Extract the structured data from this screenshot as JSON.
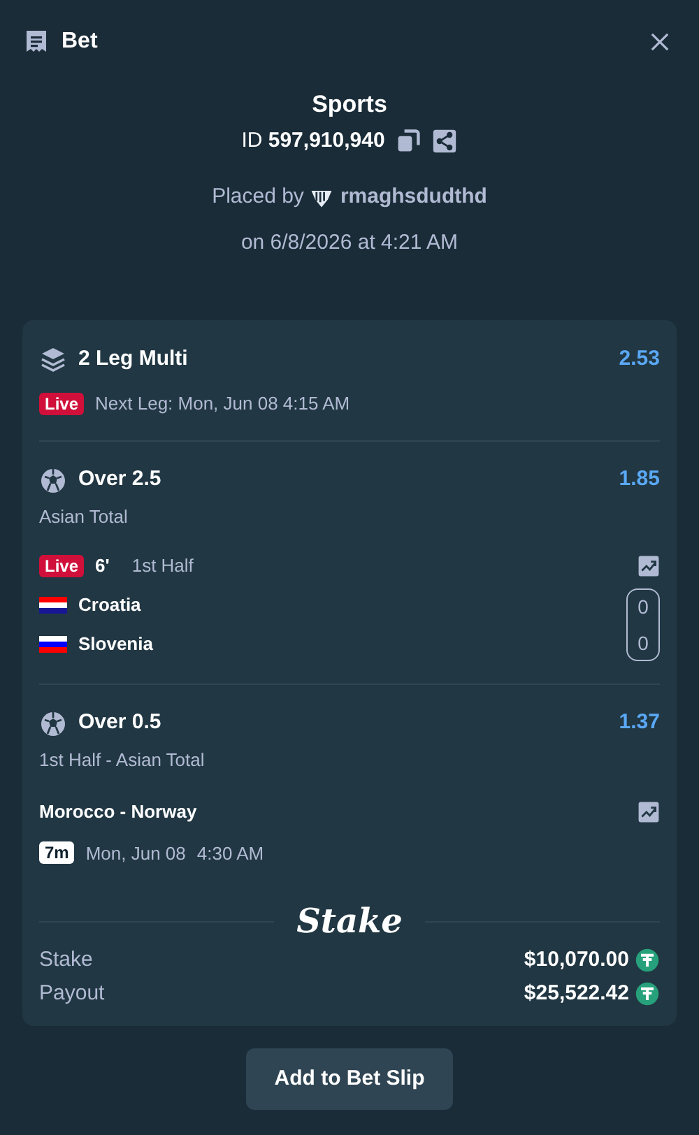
{
  "header": {
    "title": "Bet"
  },
  "bet": {
    "category": "Sports",
    "id_label": "ID",
    "id": "597,910,940",
    "placed_by_label": "Placed by",
    "user": "rmaghsdudthd",
    "placed_on": "on 6/8/2026 at 4:21 AM"
  },
  "multi": {
    "title": "2 Leg Multi",
    "odds": "2.53",
    "badge": "Live",
    "next_leg": "Next Leg: Mon, Jun 08 4:15 AM"
  },
  "legs": [
    {
      "kind": "live",
      "selection": "Over 2.5",
      "odds": "1.85",
      "market": "Asian Total",
      "badge": "Live",
      "minute": "6'",
      "period": "1st Half",
      "teams": [
        {
          "name": "Croatia",
          "score": "0"
        },
        {
          "name": "Slovenia",
          "score": "0"
        }
      ]
    },
    {
      "kind": "upcoming",
      "selection": "Over 0.5",
      "odds": "1.37",
      "market": "1st Half - Asian Total",
      "match": "Morocco - Norway",
      "countdown": "7m",
      "date": "Mon, Jun 08",
      "time": "4:30 AM"
    }
  ],
  "logo": "Stake",
  "totals": [
    {
      "label": "Stake",
      "amount": "$10,070.00"
    },
    {
      "label": "Payout",
      "amount": "$25,522.42"
    }
  ],
  "action": "Add to Bet Slip"
}
